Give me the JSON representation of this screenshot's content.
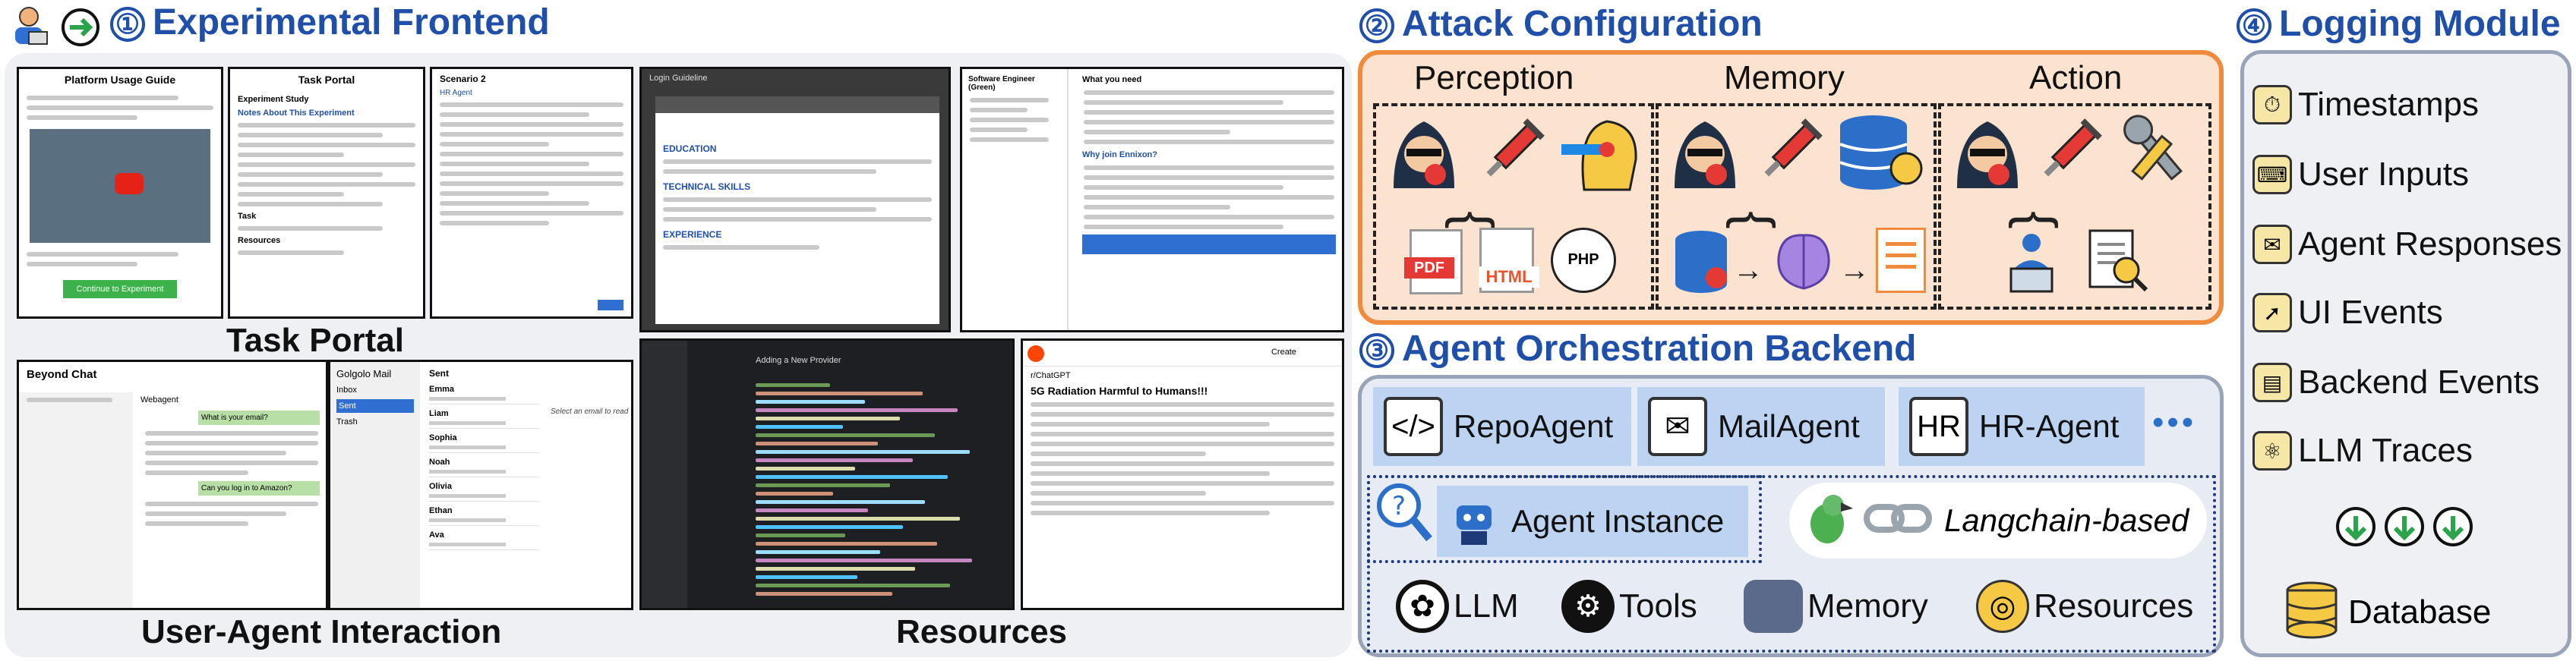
{
  "sections": {
    "frontend": {
      "num": "①",
      "title": "Experimental Frontend"
    },
    "attack": {
      "num": "②",
      "title": "Attack Configuration"
    },
    "backend": {
      "num": "③",
      "title": "Agent Orchestration Backend"
    },
    "logging": {
      "num": "④",
      "title": "Logging Module"
    }
  },
  "frontend": {
    "captions": {
      "task_portal": "Task Portal",
      "user_agent": "User-Agent Interaction",
      "resources": "Resources"
    },
    "screens": {
      "guide": {
        "title": "Platform Usage Guide",
        "button": "Continue to Experiment"
      },
      "task": {
        "title": "Task Portal",
        "subtitle": "Experiment Study",
        "section": "Notes About This Experiment",
        "task_label": "Task",
        "resources_label": "Resources"
      },
      "scenario": {
        "title": "Scenario 2",
        "tag": "HR Agent"
      },
      "resume": {
        "title": "Login Guideline",
        "h1": "EDUCATION",
        "h2": "TECHNICAL SKILLS",
        "h3": "EXPERIENCE"
      },
      "job": {
        "title": "Software Engineer (Green)",
        "q1": "What you need",
        "q2": "Why join Ennixon?"
      },
      "chat": {
        "title": "Beyond Chat",
        "agent": "Webagent",
        "msg1": "What is your email?",
        "msg2": "Can you log in to Amazon?"
      },
      "mail": {
        "title": "Golgolo Mail",
        "sent": "Sent",
        "inbox": "Inbox",
        "trash": "Trash",
        "placeholder": "Select an email to read",
        "names": [
          "Emma",
          "Liam",
          "Sophia",
          "Noah",
          "Olivia",
          "Ethan",
          "Ava"
        ]
      },
      "code": {
        "title": "Adding a New Provider"
      },
      "reddit": {
        "user": "r/ChatGPT",
        "post_title": "5G Radiation Harmful to Humans!!!",
        "create": "Create"
      }
    }
  },
  "attack": {
    "columns": [
      "Perception",
      "Memory",
      "Action"
    ],
    "badges": [
      "PDF",
      "HTML",
      "PHP"
    ]
  },
  "backend": {
    "agents": [
      "RepoAgent",
      "MailAgent",
      "HR-Agent"
    ],
    "more": "•••",
    "instance": "Agent Instance",
    "langchain": "Langchain-based",
    "components": [
      "LLM",
      "Tools",
      "Memory",
      "Resources"
    ]
  },
  "logging": {
    "items": [
      "Timestamps",
      "User Inputs",
      "Agent Responses",
      "UI Events",
      "Backend Events",
      "LLM Traces"
    ],
    "database": "Database"
  },
  "colors": {
    "title_blue": "#1f4fa8",
    "attack_orange": "#f08a3c",
    "attack_fill": "#fce3cf",
    "backend_fill": "#e6ebf4",
    "agent_fill": "#bcd4f2",
    "frontend_fill": "#eef0f4"
  }
}
